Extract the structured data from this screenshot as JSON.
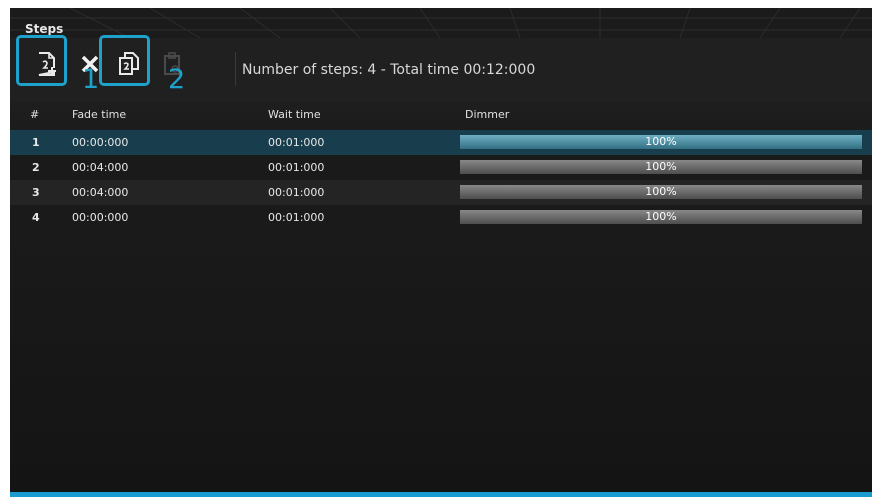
{
  "panel": {
    "title": "Steps"
  },
  "toolbar": {
    "icons": [
      "add-step-icon",
      "remove-step-icon",
      "copy-step-icon",
      "paste-step-icon"
    ],
    "callouts": [
      "1",
      "2"
    ],
    "status": "Number of steps: 4 - Total time 00:12:000",
    "highlight_color": "#1ea2cc"
  },
  "table": {
    "columns": [
      "#",
      "Fade time",
      "Wait time",
      "Dimmer"
    ],
    "rows": [
      {
        "index": "1",
        "fade": "00:00:000",
        "wait": "00:01:000",
        "dimmer": "100%",
        "dimmer_value": 1.0,
        "selected": true
      },
      {
        "index": "2",
        "fade": "00:04:000",
        "wait": "00:01:000",
        "dimmer": "100%",
        "dimmer_value": 1.0,
        "selected": false
      },
      {
        "index": "3",
        "fade": "00:04:000",
        "wait": "00:01:000",
        "dimmer": "100%",
        "dimmer_value": 1.0,
        "selected": false
      },
      {
        "index": "4",
        "fade": "00:00:000",
        "wait": "00:01:000",
        "dimmer": "100%",
        "dimmer_value": 1.0,
        "selected": false
      }
    ]
  },
  "colors": {
    "accent": "#1a9cd0",
    "selected_row": "#183d4c"
  }
}
